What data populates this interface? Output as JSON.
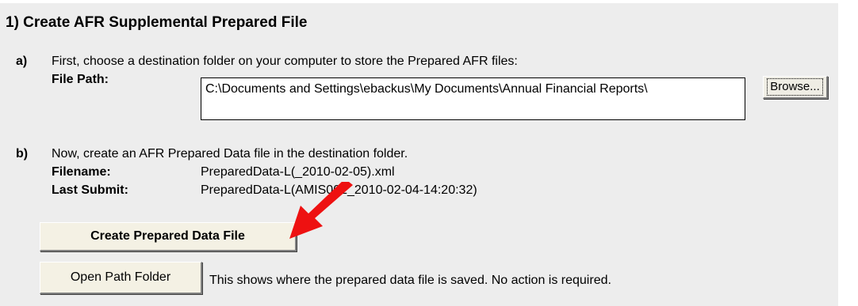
{
  "section": {
    "title": "1) Create AFR Supplemental Prepared File"
  },
  "step_a": {
    "letter": "a)",
    "instruction": "First, choose a destination folder on your computer to store the Prepared AFR files:",
    "file_path_label": "File Path:",
    "file_path_value": "C:\\Documents and Settings\\ebackus\\My Documents\\Annual Financial Reports\\",
    "browse_label": "Browse..."
  },
  "step_b": {
    "letter": "b)",
    "instruction": "Now, create an AFR Prepared Data file in the destination folder.",
    "filename_label": "Filename:",
    "filename_value": "PreparedData-L(_2010-02-05).xml",
    "last_submit_label": "Last Submit:",
    "last_submit_value": "PreparedData-L(AMIS002_2010-02-04-14:20:32)",
    "create_button_label": "Create Prepared Data File",
    "open_folder_button_label": "Open Path Folder",
    "open_folder_note": "This shows where the prepared data file is saved.  No action is required."
  },
  "annotation": {
    "arrow_color": "#ee1111"
  }
}
